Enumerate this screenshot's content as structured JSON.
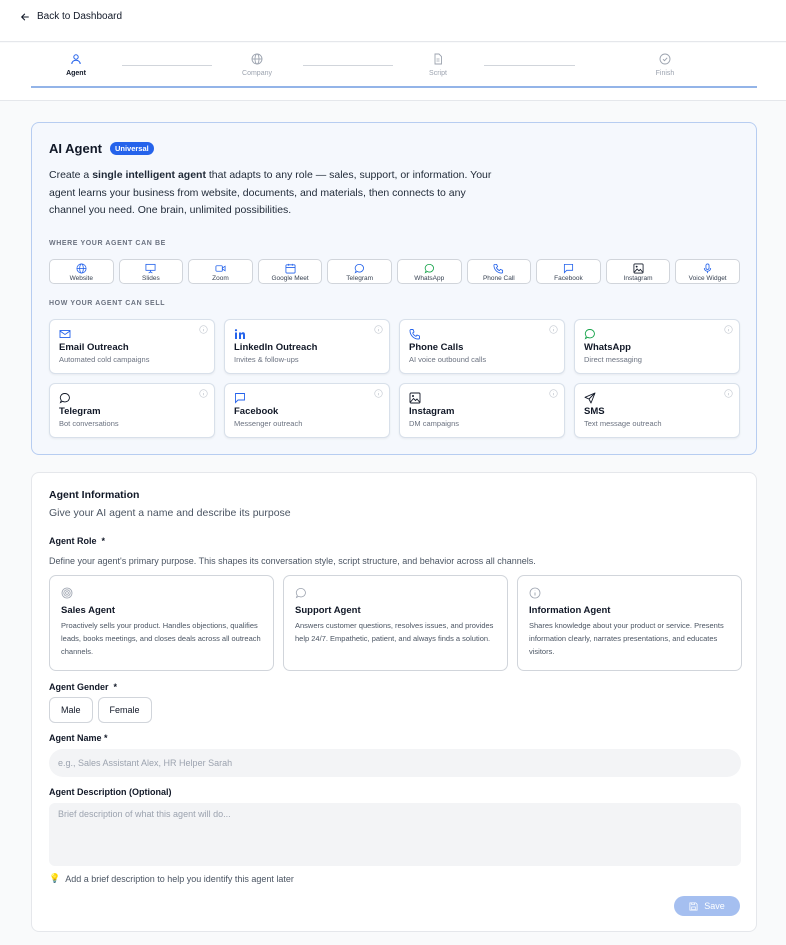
{
  "nav": {
    "back_label": "Back to Dashboard"
  },
  "steps": [
    {
      "label": "Agent",
      "icon": "user-icon",
      "active": true
    },
    {
      "label": "Company",
      "icon": "globe-icon",
      "active": false
    },
    {
      "label": "Script",
      "icon": "document-icon",
      "active": false
    },
    {
      "label": "Finish",
      "icon": "check-circle-icon",
      "active": false
    }
  ],
  "hero": {
    "title": "AI Agent",
    "badge": "Universal",
    "intro_pre": "Create a ",
    "intro_bold": "single intelligent agent",
    "intro_post": " that adapts to any role — sales, support, or information. Your agent learns your business from website, documents, and materials, then connects to any channel you need. One brain, unlimited possibilities."
  },
  "channels_heading": "WHERE YOUR AGENT CAN BE",
  "channels": [
    {
      "label": "Website",
      "icon": "globe-icon"
    },
    {
      "label": "Slides",
      "icon": "presentation-icon"
    },
    {
      "label": "Zoom",
      "icon": "video-icon"
    },
    {
      "label": "Google Meet",
      "icon": "calendar-icon"
    },
    {
      "label": "Telegram",
      "icon": "chat-bubble-icon"
    },
    {
      "label": "WhatsApp",
      "icon": "whatsapp-icon"
    },
    {
      "label": "Phone Call",
      "icon": "phone-icon"
    },
    {
      "label": "Facebook",
      "icon": "message-square-icon"
    },
    {
      "label": "Instagram",
      "icon": "image-icon"
    },
    {
      "label": "Voice Widget",
      "icon": "mic-icon"
    }
  ],
  "sell_heading": "HOW YOUR AGENT CAN SELL",
  "sell": [
    {
      "title": "Email Outreach",
      "desc": "Automated cold campaigns",
      "icon": "mail-icon"
    },
    {
      "title": "LinkedIn Outreach",
      "desc": "Invites & follow-ups",
      "icon": "linkedin-icon"
    },
    {
      "title": "Phone Calls",
      "desc": "AI voice outbound calls",
      "icon": "phone-icon"
    },
    {
      "title": "WhatsApp",
      "desc": "Direct messaging",
      "icon": "whatsapp-icon"
    },
    {
      "title": "Telegram",
      "desc": "Bot conversations",
      "icon": "chat-bubble-icon"
    },
    {
      "title": "Facebook",
      "desc": "Messenger outreach",
      "icon": "message-square-icon"
    },
    {
      "title": "Instagram",
      "desc": "DM campaigns",
      "icon": "image-icon"
    },
    {
      "title": "SMS",
      "desc": "Text message outreach",
      "icon": "send-icon"
    }
  ],
  "form": {
    "title": "Agent Information",
    "subtitle": "Give your AI agent a name and describe its purpose",
    "role_label": "Agent Role",
    "role_required": "*",
    "role_help": "Define your agent's primary purpose. This shapes its conversation style, script structure, and behavior across all channels.",
    "roles": [
      {
        "title": "Sales Agent",
        "desc": "Proactively sells your product. Handles objections, qualifies leads, books meetings, and closes deals across all outreach channels.",
        "icon": "target-icon"
      },
      {
        "title": "Support Agent",
        "desc": "Answers customer questions, resolves issues, and provides help 24/7. Empathetic, patient, and always finds a solution.",
        "icon": "chat-bubble-icon"
      },
      {
        "title": "Information Agent",
        "desc": "Shares knowledge about your product or service. Presents information clearly, narrates presentations, and educates visitors.",
        "icon": "info-icon"
      }
    ],
    "gender_label": "Agent Gender",
    "gender_required": "*",
    "genders": [
      "Male",
      "Female"
    ],
    "name_label": "Agent Name *",
    "name_placeholder": "e.g., Sales Assistant Alex, HR Helper Sarah",
    "name_value": "",
    "desc_label": "Agent Description (Optional)",
    "desc_placeholder": "Brief description of what this agent will do...",
    "desc_value": "",
    "tip": "Add a brief description to help you identify this agent later",
    "save_label": "Save"
  },
  "colors": {
    "accent": "#2563eb",
    "whatsapp": "#16a34a",
    "save_disabled": "#a5bff0"
  }
}
